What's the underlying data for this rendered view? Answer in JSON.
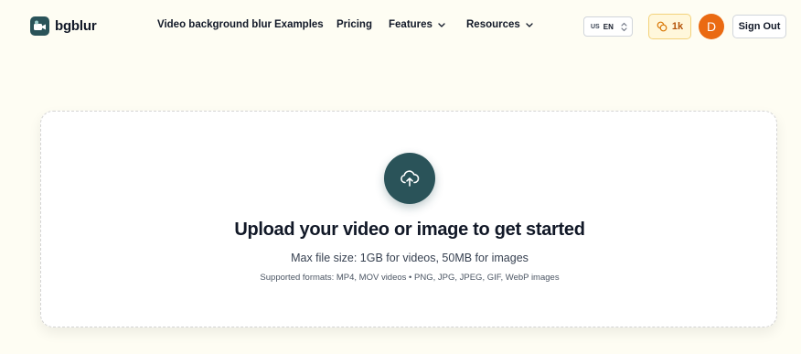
{
  "header": {
    "brand": "bgblur",
    "nav": [
      {
        "label": "Video background blur"
      },
      {
        "label": "Examples"
      },
      {
        "label": "Pricing"
      },
      {
        "label": "Features"
      },
      {
        "label": "Resources"
      }
    ],
    "language": {
      "flag": "US",
      "code": "EN"
    },
    "credits": "1k",
    "avatar_initial": "D",
    "signout_label": "Sign Out"
  },
  "upload": {
    "title": "Upload your video or image to get started",
    "max_size": "Max file size: 1GB for videos, 50MB for images",
    "formats": "Supported formats: MP4, MOV videos • PNG, JPG, JPEG, GIF, WebP images"
  },
  "colors": {
    "background": "#fefdf3",
    "brand": "#2a5359",
    "avatar": "#ea6a12",
    "credits_text": "#b45309"
  },
  "icons": [
    "logo-icon",
    "chevron-down-icon",
    "updown-icon",
    "coins-icon",
    "cloud-upload-icon"
  ]
}
